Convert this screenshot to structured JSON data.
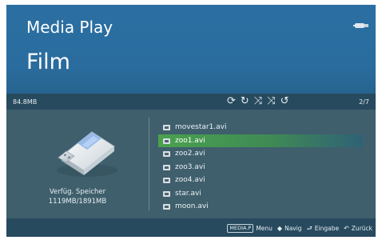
{
  "header": {
    "app_title": "Media Play",
    "section_title": "Film",
    "usb_icon": "usb-icon"
  },
  "status_bar": {
    "storage_size": "84.8MB",
    "page_counter": "2/7",
    "mode_icons": [
      {
        "name": "repeat-one-icon",
        "glyph": "⟳"
      },
      {
        "name": "repeat-all-icon",
        "glyph": "↻"
      },
      {
        "name": "shuffle-icon",
        "glyph": "⤨"
      },
      {
        "name": "shuffle-all-icon",
        "glyph": "⤨"
      },
      {
        "name": "repeat-off-icon",
        "glyph": "↺"
      }
    ]
  },
  "storage": {
    "label": "Verfüg. Speicher",
    "value": "1119MB/1891MB"
  },
  "files": [
    {
      "name": "movestar1.avi",
      "selected": false
    },
    {
      "name": "zoo1.avi",
      "selected": true
    },
    {
      "name": "zoo2.avi",
      "selected": false
    },
    {
      "name": "zoo3.avi",
      "selected": false
    },
    {
      "name": "zoo4.avi",
      "selected": false
    },
    {
      "name": "star.avi",
      "selected": false
    },
    {
      "name": "moon.avi",
      "selected": false
    }
  ],
  "footer": {
    "media_key": "MEDIA.P",
    "menu_label": "Menu",
    "nav_glyph": "◆",
    "nav_label": "Navig",
    "enter_glyph": "⮐",
    "enter_label": "Eingabe",
    "back_glyph": "↶",
    "back_label": "Zurück"
  }
}
